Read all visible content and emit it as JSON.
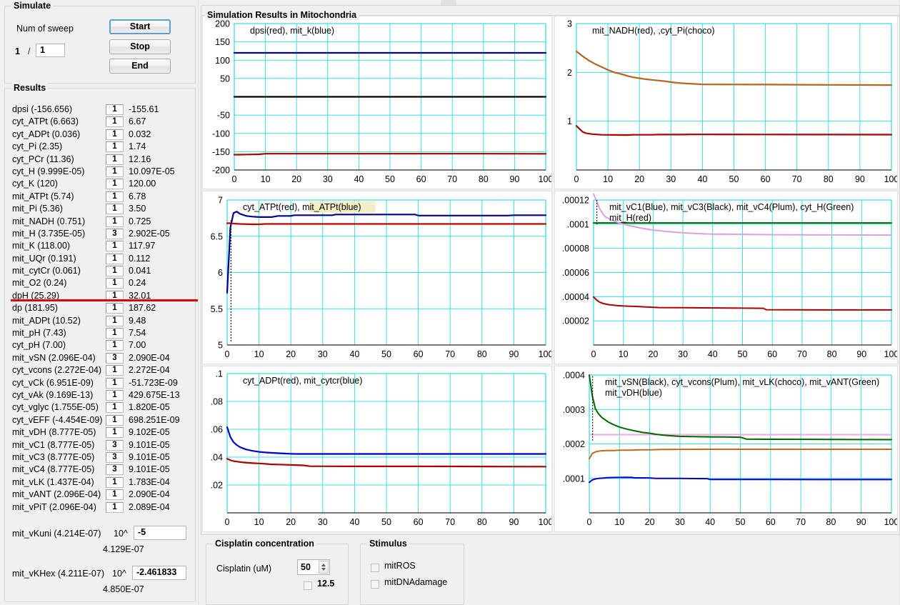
{
  "simulate": {
    "title": "Simulate",
    "num_of_sweep_label": "Num of sweep",
    "sweep_current": "1",
    "sweep_separator": "/",
    "sweep_total": "1",
    "start_label": "Start",
    "stop_label": "Stop",
    "end_label": "End"
  },
  "results": {
    "title": "Results",
    "rows": [
      {
        "name": "dpsi (-156.656)",
        "index": "1",
        "value": "-155.61"
      },
      {
        "name": "cyt_ATPt (6.663)",
        "index": "1",
        "value": "6.67"
      },
      {
        "name": "cyt_ADPt (0.036)",
        "index": "1",
        "value": "0.032"
      },
      {
        "name": "cyt_Pi (2.35)",
        "index": "1",
        "value": "1.74"
      },
      {
        "name": "cyt_PCr (11.36)",
        "index": "1",
        "value": "12.16"
      },
      {
        "name": "cyt_H (9.999E-05)",
        "index": "1",
        "value": "10.097E-05"
      },
      {
        "name": "cyt_K (120)",
        "index": "1",
        "value": "120.00"
      },
      {
        "name": "mit_ATPt (5.74)",
        "index": "1",
        "value": "6.78"
      },
      {
        "name": "mit_Pi (5.36)",
        "index": "1",
        "value": "3.50"
      },
      {
        "name": "mit_NADH (0.751)",
        "index": "1",
        "value": "0.725"
      },
      {
        "name": "mit_H (3.735E-05)",
        "index": "3",
        "value": "2.902E-05"
      },
      {
        "name": "mit_K (118.00)",
        "index": "1",
        "value": "117.97"
      },
      {
        "name": "mit_UQr (0.191)",
        "index": "1",
        "value": "0.112"
      },
      {
        "name": "mit_cytCr (0.061)",
        "index": "1",
        "value": "0.041"
      },
      {
        "name": "mit_O2 (0.24)",
        "index": "1",
        "value": "0.24"
      },
      {
        "name": "dpH (25.29)",
        "index": "1",
        "value": "32.01"
      },
      {
        "name": "dp (181.95)",
        "index": "1",
        "value": "187.62"
      },
      {
        "name": "mit_ADPt (10.52)",
        "index": "1",
        "value": "9.48"
      },
      {
        "name": "mit_pH (7.43)",
        "index": "1",
        "value": "7.54"
      },
      {
        "name": "cyt_pH (7.00)",
        "index": "1",
        "value": "7.00"
      },
      {
        "name": "mit_vSN (2.096E-04)",
        "index": "3",
        "value": "2.090E-04"
      },
      {
        "name": "cyt_vcons (2.272E-04)",
        "index": "1",
        "value": "2.272E-04"
      },
      {
        "name": "cyt_vCk (6.951E-09)",
        "index": "1",
        "value": "-51.723E-09"
      },
      {
        "name": "cyt_vAk (9.169E-13)",
        "index": "1",
        "value": "429.675E-13"
      },
      {
        "name": "cyt_vglyc (1.755E-05)",
        "index": "1",
        "value": "1.820E-05"
      },
      {
        "name": "cyt_vEFF (-4.454E-09)",
        "index": "1",
        "value": "698.251E-09"
      },
      {
        "name": "mit_vDH (8.777E-05)",
        "index": "1",
        "value": "9.102E-05"
      },
      {
        "name": "mit_vC1 (8.777E-05)",
        "index": "3",
        "value": "9.101E-05"
      },
      {
        "name": "mit_vC3 (8.777E-05)",
        "index": "3",
        "value": "9.101E-05"
      },
      {
        "name": "mit_vC4 (8.777E-05)",
        "index": "3",
        "value": "9.101E-05"
      },
      {
        "name": "mit_vLK (1.437E-04)",
        "index": "1",
        "value": "1.783E-04"
      },
      {
        "name": "mit_vANT (2.096E-04)",
        "index": "1",
        "value": "2.090E-04"
      },
      {
        "name": "mit_vPiT (2.096E-04)",
        "index": "1",
        "value": "2.089E-04"
      }
    ],
    "highlight_color": "#e00000",
    "power_rows": [
      {
        "name": "mit_vKuni (4.214E-07)",
        "exponent_label": "10^",
        "exponent_value": "-5",
        "result": "4.129E-07"
      },
      {
        "name": "mit_vKHex (4.211E-07)",
        "exponent_label": "10^",
        "exponent_value": "-2.461833",
        "result": "4.850E-07"
      }
    ]
  },
  "sim_results": {
    "title": "Simulation Results in Mitochondria"
  },
  "cisplatin": {
    "title": "Cisplatin concentration",
    "label": "Cisplatin (uM)",
    "value": "50",
    "checkbox_label": "12.5",
    "checkbox_checked": false
  },
  "stimulus": {
    "title": "Stimulus",
    "items": [
      {
        "label": "mitROS",
        "checked": false
      },
      {
        "label": "mitDNAdamage",
        "checked": false
      }
    ]
  },
  "chart_data": [
    {
      "id": "chart-dpsi",
      "type": "line",
      "title": "dpsi(red), mit_k(blue)",
      "title_highlight": null,
      "xlabel": "",
      "ylabel": "",
      "xlim": [
        0,
        100
      ],
      "ylim": [
        -200,
        200
      ],
      "xticks": [
        0,
        10,
        20,
        30,
        40,
        50,
        60,
        70,
        80,
        90,
        100
      ],
      "yticks": [
        200,
        150,
        100,
        50,
        -50,
        -100,
        -150,
        -200
      ],
      "yticklabels": [
        "200",
        "150",
        "100",
        "50",
        "-50",
        "-100",
        "-150",
        "-200"
      ],
      "grid": true,
      "series": [
        {
          "name": "mit_k",
          "color": "#00008b",
          "x": [
            0,
            5,
            10,
            20,
            40,
            60,
            80,
            100
          ],
          "values": [
            120,
            120,
            120,
            120,
            120,
            120,
            120,
            120
          ]
        },
        {
          "name": "zero-axis",
          "color": "#000000",
          "x": [
            0,
            100
          ],
          "values": [
            0,
            0
          ]
        },
        {
          "name": "dpsi",
          "color": "#aa0000",
          "x": [
            0,
            2,
            4,
            6,
            8,
            10,
            20,
            40,
            60,
            80,
            100
          ],
          "values": [
            -158,
            -158,
            -157.6,
            -157.4,
            -157,
            -155.6,
            -155.6,
            -155.6,
            -155.6,
            -155.6,
            -155.61
          ]
        }
      ]
    },
    {
      "id": "chart-nadh",
      "type": "line",
      "title": "mit_NADH(red), ,cyt_Pi(choco)",
      "xlim": [
        0,
        100
      ],
      "ylim": [
        0,
        3
      ],
      "xticks": [
        0,
        10,
        20,
        30,
        40,
        50,
        60,
        70,
        80,
        90,
        100
      ],
      "yticks": [
        3,
        2,
        1
      ],
      "yticklabels": [
        "3",
        "2",
        "1"
      ],
      "grid": true,
      "series": [
        {
          "name": "cyt_Pi",
          "color": "#b5651d",
          "x": [
            0,
            2,
            4,
            6,
            8,
            10,
            12,
            14,
            16,
            18,
            20,
            22,
            25,
            28,
            30,
            33,
            36,
            40,
            50,
            60,
            80,
            100
          ],
          "values": [
            2.43,
            2.33,
            2.24,
            2.17,
            2.11,
            2.05,
            2.0,
            1.97,
            1.93,
            1.9,
            1.88,
            1.86,
            1.84,
            1.82,
            1.8,
            1.78,
            1.77,
            1.755,
            1.752,
            1.75,
            1.745,
            1.74
          ]
        },
        {
          "name": "mit_NADH",
          "color": "#aa0000",
          "x": [
            0,
            1,
            2,
            3,
            5,
            8,
            12,
            16,
            18,
            20,
            24,
            26,
            30,
            34,
            36,
            40,
            60,
            80,
            100
          ],
          "values": [
            0.905,
            0.84,
            0.78,
            0.755,
            0.735,
            0.722,
            0.718,
            0.716,
            0.722,
            0.722,
            0.722,
            0.726,
            0.726,
            0.726,
            0.729,
            0.729,
            0.727,
            0.726,
            0.725
          ]
        }
      ]
    },
    {
      "id": "chart-atpt",
      "type": "line",
      "title": "cyt_ATPt(red), mit_ATPt(blue)",
      "title_highlight_text": "mit_ATPt(blue)",
      "title_highlight_color": "#f4efc8",
      "xlim": [
        0,
        100
      ],
      "ylim": [
        5,
        7
      ],
      "xticks": [
        0,
        10,
        20,
        30,
        40,
        50,
        60,
        70,
        80,
        90,
        100
      ],
      "yticks": [
        7,
        6.5,
        6,
        5.5,
        5
      ],
      "yticklabels": [
        "7",
        "6.5",
        "6",
        "5.5",
        "5"
      ],
      "grid": true,
      "series": [
        {
          "name": "mit_ATPt",
          "color": "#00008b",
          "x": [
            0,
            1,
            2,
            3,
            4,
            6,
            8,
            10,
            14,
            16,
            20,
            21,
            30,
            33,
            34,
            50,
            59,
            60,
            75,
            88,
            90,
            100
          ],
          "values": [
            5.72,
            6.62,
            6.82,
            6.84,
            6.81,
            6.78,
            6.77,
            6.765,
            6.765,
            6.78,
            6.78,
            6.79,
            6.79,
            6.79,
            6.8,
            6.8,
            6.8,
            6.785,
            6.785,
            6.785,
            6.79,
            6.79
          ]
        },
        {
          "name": "cyt_ATPt",
          "color": "#c00000",
          "x": [
            0,
            1,
            2,
            4,
            8,
            10,
            12,
            20,
            40,
            60,
            80,
            100
          ],
          "values": [
            6.68,
            6.68,
            6.675,
            6.67,
            6.665,
            6.665,
            6.67,
            6.67,
            6.67,
            6.67,
            6.67,
            6.67
          ]
        }
      ]
    },
    {
      "id": "chart-vc",
      "type": "line",
      "title_line1": "mit_vC1(Blue), mit_vC3(Black), mit_vC4(Plum),  cyt_H(Green)",
      "title_line2": "mit_H(red)",
      "xlim": [
        0,
        100
      ],
      "ylim": [
        0,
        0.00012
      ],
      "xticks": [
        0,
        10,
        20,
        30,
        40,
        50,
        60,
        70,
        80,
        90,
        100
      ],
      "yticks": [
        0.00012,
        0.0001,
        8e-05,
        6e-05,
        4e-05,
        2e-05
      ],
      "yticklabels": [
        ".00012",
        ".0001",
        ".00008",
        ".00006",
        ".00004",
        ".00002"
      ],
      "grid": true,
      "series": [
        {
          "name": "cyt_H",
          "color": "#006400",
          "x": [
            0,
            100
          ],
          "values": [
            0.000101,
            0.000101
          ]
        },
        {
          "name": "mit_vC4",
          "color": "#dda0dd",
          "x": [
            0,
            1,
            2,
            3,
            4,
            6,
            8,
            10,
            12,
            14,
            16,
            18,
            20,
            22,
            25,
            28,
            32,
            36,
            40,
            60,
            80,
            100
          ],
          "values": [
            0.000125,
            0.000119,
            0.000113,
            0.000109,
            0.000106,
            0.0001035,
            0.0001015,
            0.0001,
            9.88e-05,
            9.77e-05,
            9.67e-05,
            9.58e-05,
            9.51e-05,
            9.46e-05,
            9.39e-05,
            9.33e-05,
            9.26e-05,
            9.21e-05,
            9.18e-05,
            9.13e-05,
            9.11e-05,
            9.1e-05
          ]
        },
        {
          "name": "mit_H",
          "color": "#aa0000",
          "x": [
            0,
            1,
            2,
            3,
            5,
            8,
            10,
            14,
            16,
            20,
            22,
            30,
            40,
            50,
            57,
            58,
            70,
            85,
            100
          ],
          "values": [
            3.98e-05,
            3.73e-05,
            3.55e-05,
            3.45e-05,
            3.34e-05,
            3.26e-05,
            3.23e-05,
            3.19e-05,
            3.17e-05,
            3.12e-05,
            3.1e-05,
            3.09e-05,
            3.07e-05,
            3.05e-05,
            3.04e-05,
            2.92e-05,
            2.91e-05,
            2.9e-05,
            2.9e-05
          ]
        }
      ]
    },
    {
      "id": "chart-adpt",
      "type": "line",
      "title": "cyt_ADPt(red), mit_cytcr(blue)",
      "xlim": [
        0,
        100
      ],
      "ylim": [
        0,
        0.1
      ],
      "xticks": [
        0,
        10,
        20,
        30,
        40,
        50,
        60,
        70,
        80,
        90,
        100
      ],
      "yticks": [
        0.1,
        0.08,
        0.06,
        0.04,
        0.02
      ],
      "yticklabels": [
        ".1",
        ".08",
        ".06",
        ".04",
        ".02"
      ],
      "grid": true,
      "series": [
        {
          "name": "mit_cytcr",
          "color": "#0000cc",
          "x": [
            0,
            1,
            2,
            3,
            4,
            5,
            6,
            8,
            10,
            12,
            14,
            16,
            18,
            20,
            21,
            30,
            50,
            70,
            90,
            100
          ],
          "values": [
            0.0615,
            0.0545,
            0.0508,
            0.0487,
            0.0473,
            0.0463,
            0.0455,
            0.0445,
            0.0438,
            0.0434,
            0.0431,
            0.0428,
            0.0426,
            0.0424,
            0.0423,
            0.0423,
            0.0423,
            0.0423,
            0.0423,
            0.0423
          ]
        },
        {
          "name": "cyt_ADPt",
          "color": "#aa0000",
          "x": [
            0,
            1,
            2,
            3,
            5,
            8,
            10,
            12,
            14,
            16,
            20,
            24,
            26,
            40,
            60,
            80,
            100
          ],
          "values": [
            0.0388,
            0.0378,
            0.0372,
            0.0368,
            0.0362,
            0.0357,
            0.0355,
            0.0352,
            0.0348,
            0.0347,
            0.0344,
            0.0341,
            0.0335,
            0.0334,
            0.0334,
            0.0333,
            0.0332
          ]
        }
      ]
    },
    {
      "id": "chart-vsn",
      "type": "line",
      "title_line1": "mit_vSN(Black), cyt_vcons(Plum), mit_vLK(choco), mit_vANT(Green)",
      "title_line2": "mit_vDH(blue)",
      "xlim": [
        0,
        100
      ],
      "ylim": [
        0,
        0.0004
      ],
      "xticks": [
        0,
        10,
        20,
        30,
        40,
        50,
        60,
        70,
        80,
        90,
        100
      ],
      "yticks": [
        0.0004,
        0.0003,
        0.0002,
        0.0001
      ],
      "yticklabels": [
        ".0004",
        ".0003",
        ".0002",
        ".0001"
      ],
      "grid": true,
      "series": [
        {
          "name": "cyt_vcons",
          "color": "#eeaadd",
          "x": [
            0,
            100
          ],
          "values": [
            0.000227,
            0.000227
          ]
        },
        {
          "name": "mit_vANT",
          "color": "#006400",
          "x": [
            0,
            1,
            2,
            3,
            4,
            6,
            8,
            10,
            12,
            15,
            18,
            20,
            22,
            25,
            28,
            30,
            32,
            36,
            40,
            45,
            50,
            52,
            60,
            80,
            100
          ],
          "values": [
            0.0004,
            0.00034,
            0.000302,
            0.000288,
            0.000278,
            0.000265,
            0.000256,
            0.000249,
            0.000244,
            0.000238,
            0.000233,
            0.000231,
            0.000228,
            0.000225,
            0.000223,
            0.000222,
            0.0002215,
            0.000221,
            0.0002205,
            0.00022,
            0.0002195,
            0.000214,
            0.0002135,
            0.000213,
            0.0002125
          ]
        },
        {
          "name": "mit_vLK",
          "color": "#c1681e",
          "x": [
            0,
            1,
            2,
            3,
            4,
            6,
            8,
            10,
            12,
            14,
            16,
            18,
            20,
            22,
            24,
            26,
            30,
            40,
            60,
            80,
            100
          ],
          "values": [
            0.000157,
            0.000172,
            0.000177,
            0.000179,
            0.00018,
            0.000181,
            0.000181,
            0.000182,
            0.000182,
            0.000182,
            0.0001825,
            0.000183,
            0.000183,
            0.0001835,
            0.000184,
            0.000184,
            0.0001842,
            0.0001845,
            0.0001845,
            0.0001845,
            0.0001845
          ]
        },
        {
          "name": "mit_vDH",
          "color": "#0000cc",
          "x": [
            0,
            1,
            2,
            3,
            4,
            6,
            8,
            10,
            12,
            14,
            15,
            20,
            22,
            27,
            30,
            35,
            39,
            40,
            60,
            80,
            100
          ],
          "values": [
            8.85e-05,
            9.55e-05,
            9.85e-05,
            0.0001,
            0.0001005,
            0.000102,
            0.0001025,
            0.0001027,
            0.000103,
            0.0001028,
            0.0001015,
            0.0001013,
            0.0001002,
            0.0001,
            9.98e-05,
            9.95e-05,
            9.93e-05,
            9.68e-05,
            9.67e-05,
            9.65e-05,
            9.65e-05
          ]
        }
      ]
    }
  ]
}
